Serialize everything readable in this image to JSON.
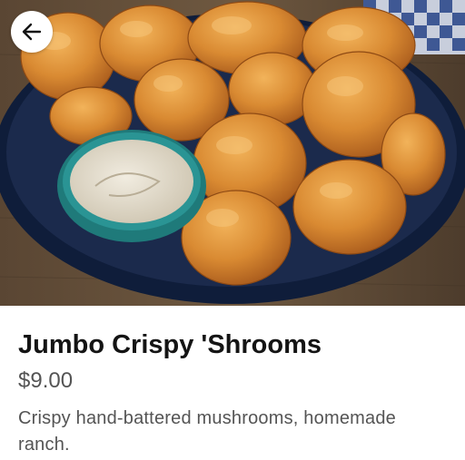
{
  "item": {
    "name": "Jumbo Crispy 'Shrooms",
    "price": "$9.00",
    "description": "Crispy hand-battered mushrooms, homemade ranch."
  },
  "icons": {
    "back": "arrow-left-icon"
  },
  "image": {
    "subject": "fried-mushrooms-with-ranch-dip"
  },
  "colors": {
    "title": "#141414",
    "body_text": "#545454",
    "background": "#ffffff"
  }
}
